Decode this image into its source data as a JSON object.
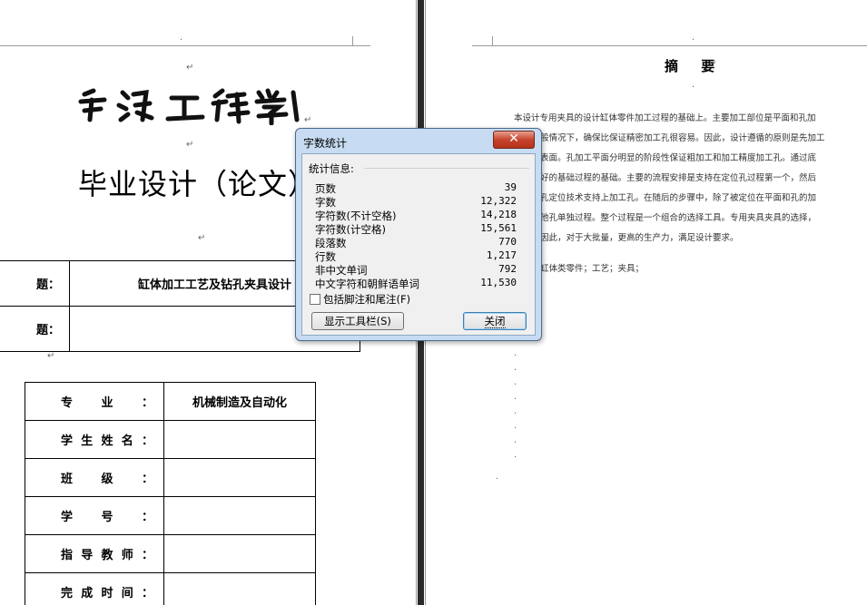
{
  "left_page": {
    "college_name": "宁波工程学院",
    "thesis_title": "毕业设计（论文）",
    "topic_rows": [
      {
        "label": "题：",
        "value": "缸体加工工艺及钻孔夹具设计"
      },
      {
        "label": "题：",
        "value": ""
      }
    ],
    "info_rows": [
      {
        "label": "专 业：",
        "value": "机械制造及自动化"
      },
      {
        "label": "学 生 姓 名：",
        "value": ""
      },
      {
        "label": "班 级：",
        "value": ""
      },
      {
        "label": "学 号：",
        "value": ""
      },
      {
        "label": "指 导 教 师：",
        "value": ""
      },
      {
        "label": "完 成 时 间：",
        "value": ""
      }
    ]
  },
  "right_page": {
    "abstract_heading": "摘 要",
    "abstract_lines": [
      "本设计专用夹具的设计缸体零件加工过程的基础上。主要加工部位是平面和孔加",
      "般情况下，确保比保证精密加工孔很容易。因此，设计遵循的原则是先加工",
      "表面。孔加工平面分明显的阶段性保证粗加工和加工精度加工孔。通过底",
      "好的基础过程的基础。主要的流程安排是支持在定位孔过程第一个，然后",
      "孔定位技术支持上加工孔。在随后的步骤中，除了被定位在平面和孔的加",
      "他孔单独过程。整个过程是一个组合的选择工具。专用夹具夹具的选择，",
      "因此，对于大批量，更高的生产力，满足设计要求。",
      "缸体类零件；工艺；夹具；"
    ]
  },
  "dialog": {
    "title": "字数统计",
    "close_glyph": "✕",
    "stats_header": "统计信息:",
    "stats": [
      {
        "name": "页数",
        "value": "39"
      },
      {
        "name": "字数",
        "value": "12,322"
      },
      {
        "name": "字符数(不计空格)",
        "value": "14,218"
      },
      {
        "name": "字符数(计空格)",
        "value": "15,561"
      },
      {
        "name": "段落数",
        "value": "770"
      },
      {
        "name": "行数",
        "value": "1,217"
      },
      {
        "name": "非中文单词",
        "value": "792"
      },
      {
        "name": "中文字符和朝鲜语单词",
        "value": "11,530"
      }
    ],
    "footnote_option": "包括脚注和尾注(F)",
    "footnote_checked": false,
    "show_toolbar_label": "显示工具栏(S)",
    "close_label": "关闭"
  }
}
